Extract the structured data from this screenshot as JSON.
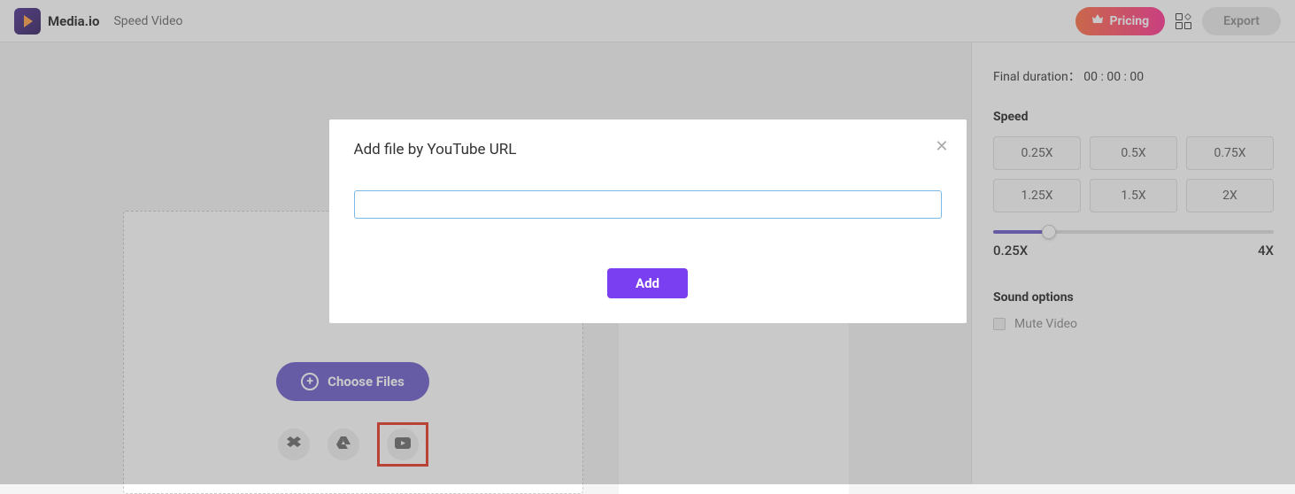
{
  "header": {
    "brand": "Media.io",
    "page_title": "Speed Video",
    "pricing_label": "Pricing",
    "export_label": "Export"
  },
  "upload": {
    "choose_files_label": "Choose Files"
  },
  "sidebar": {
    "duration_label": "Final duration：",
    "duration_value": "00 : 00 : 00",
    "speed_label": "Speed",
    "speeds": [
      "0.25X",
      "0.5X",
      "0.75X",
      "1.25X",
      "1.5X",
      "2X"
    ],
    "slider_min": "0.25X",
    "slider_max": "4X",
    "sound_label": "Sound options",
    "mute_label": "Mute Video"
  },
  "modal": {
    "title": "Add file by YouTube URL",
    "add_label": "Add"
  }
}
